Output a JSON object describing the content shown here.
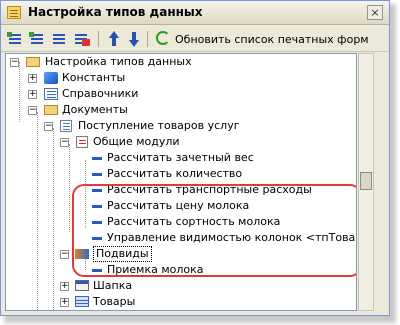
{
  "window": {
    "title": "Настройка типов данных",
    "close_symbol": "×"
  },
  "toolbar": {
    "refresh_label": "Обновить список печатных форм"
  },
  "tree": {
    "root": "Настройка типов данных",
    "constants": "Константы",
    "references": "Справочники",
    "documents": "Документы",
    "document_receipt": "Поступление товаров услуг",
    "common_modules": "Общие модули",
    "modules": [
      "Рассчитать зачетный вес",
      "Рассчитать количество",
      "Рассчитать транспортные расходы",
      "Рассчитать цену молока",
      "Рассчитать сортность молока"
    ],
    "column_visibility": "Управление видимостью колонок <тпТовары>",
    "subscriptions": "Подвиды",
    "milk_receipt": "Приемка молока",
    "header": "Шапка",
    "goods": "Товары"
  },
  "colors": {
    "highlight": "#e03a3a",
    "accent": "#2354b4"
  }
}
